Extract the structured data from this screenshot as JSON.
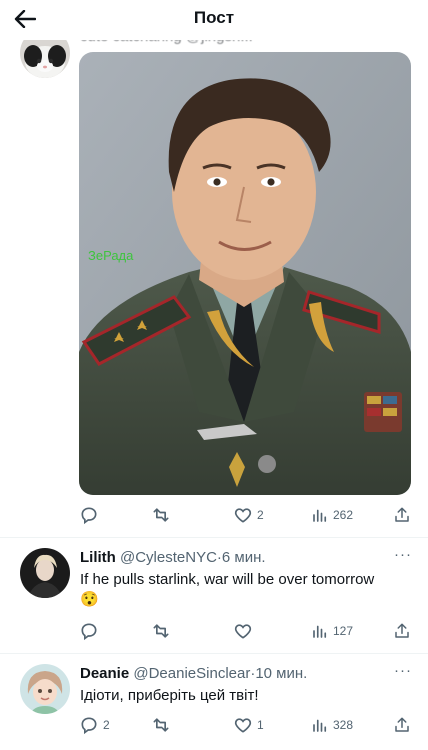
{
  "header": {
    "title": "Пост"
  },
  "main_post": {
    "author_partial": "cute catcharing @jingsh...",
    "watermark": "ЗеРада",
    "stats": {
      "replies": "",
      "reposts": "",
      "likes": "2",
      "views": "262"
    }
  },
  "replies": [
    {
      "name": "Lilith",
      "handle": "@CylesteNYC",
      "time": "6 мин.",
      "text": "If he pulls starlink, war will be over tomorrow",
      "emoji": "😯",
      "stats": {
        "replies": "",
        "reposts": "",
        "likes": "",
        "views": "127"
      }
    },
    {
      "name": "Deanie",
      "handle": "@DeanieSinclear",
      "time": "10 мин.",
      "text": "Ідіоти, приберіть цей твіт!",
      "stats": {
        "replies": "2",
        "reposts": "",
        "likes": "1",
        "views": "328"
      }
    }
  ],
  "colors": {
    "text": "#0f1419",
    "muted": "#536471",
    "divider": "#eff3f4",
    "watermark": "#3ec43e"
  },
  "icons": [
    "back-arrow-icon",
    "reply-icon",
    "repost-icon",
    "like-icon",
    "views-icon",
    "share-icon",
    "more-icon"
  ]
}
